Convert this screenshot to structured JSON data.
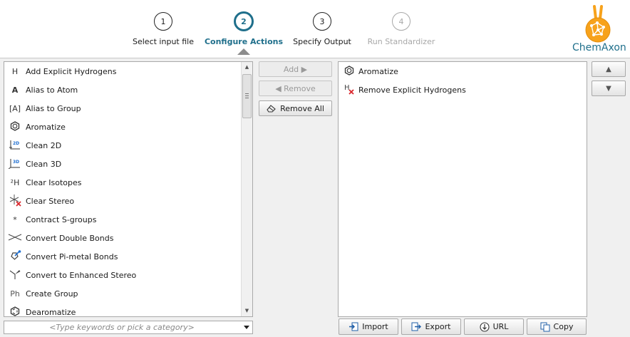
{
  "wizard": {
    "steps": [
      {
        "number": "1",
        "label": "Select input file"
      },
      {
        "number": "2",
        "label": "Configure Actions"
      },
      {
        "number": "3",
        "label": "Specify Output"
      },
      {
        "number": "4",
        "label": "Run Standardizer"
      }
    ],
    "active_step": 2,
    "brand": "ChemAxon"
  },
  "actions_list": {
    "items": [
      {
        "icon": "hydrogen-icon",
        "glyph": "H",
        "label": "Add Explicit Hydrogens"
      },
      {
        "icon": "atom-alias-icon",
        "glyph": "A",
        "label": "Alias to Atom"
      },
      {
        "icon": "group-alias-icon",
        "glyph": "[A]",
        "label": "Alias to Group"
      },
      {
        "icon": "aromatic-ring-icon",
        "glyph": "",
        "label": "Aromatize"
      },
      {
        "icon": "clean-2d-icon",
        "glyph": "",
        "label": "Clean 2D"
      },
      {
        "icon": "clean-3d-icon",
        "glyph": "",
        "label": "Clean 3D"
      },
      {
        "icon": "isotope-icon",
        "glyph": "²H",
        "label": "Clear Isotopes"
      },
      {
        "icon": "clear-stereo-icon",
        "glyph": "",
        "label": "Clear Stereo"
      },
      {
        "icon": "contract-sgroup-icon",
        "glyph": "*",
        "label": "Contract S-groups"
      },
      {
        "icon": "double-bond-icon",
        "glyph": "",
        "label": "Convert Double Bonds"
      },
      {
        "icon": "pi-metal-icon",
        "glyph": "",
        "label": "Convert Pi-metal Bonds"
      },
      {
        "icon": "enhanced-stereo-icon",
        "glyph": "",
        "label": "Convert to Enhanced Stereo"
      },
      {
        "icon": "create-group-icon",
        "glyph": "Ph",
        "label": "Create Group"
      },
      {
        "icon": "dearomatize-icon",
        "glyph": "",
        "label": "Dearomatize"
      }
    ]
  },
  "search": {
    "placeholder": "<Type keywords or pick a category>"
  },
  "middle_buttons": {
    "add": "Add ▶",
    "remove": "◀ Remove",
    "remove_all": "Remove All"
  },
  "selected_actions": {
    "items": [
      {
        "icon": "aromatic-ring-icon",
        "label": "Aromatize"
      },
      {
        "icon": "remove-hydrogen-icon",
        "label": "Remove Explicit Hydrogens"
      }
    ]
  },
  "bottom_buttons": {
    "import": "Import",
    "export": "Export",
    "url": "URL",
    "copy": "Copy"
  },
  "order_buttons": {
    "up": "▲",
    "down": "▼"
  },
  "colors": {
    "accent": "#1f6f8b",
    "logo_orange": "#f7a21b",
    "remove_red": "#d9262c"
  }
}
